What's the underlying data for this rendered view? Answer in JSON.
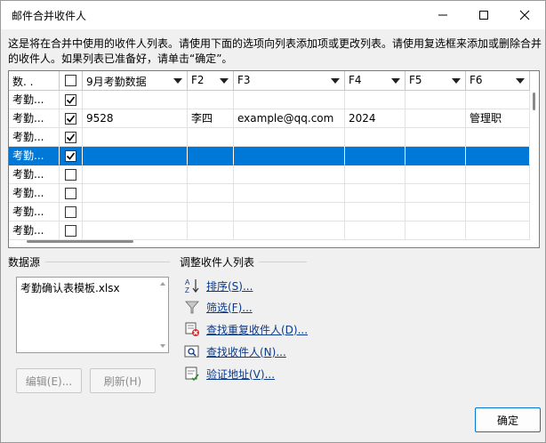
{
  "window": {
    "title": "邮件合并收件人"
  },
  "instructions": "这是将在合并中使用的收件人列表。请使用下面的选项向列表添加项或更改列表。请使用复选框来添加或删除合并的收件人。如果列表已准备好，请单击“确定”。",
  "grid": {
    "headers": [
      "数. .",
      "",
      "9月考勤数据",
      "F2",
      "F3",
      "F4",
      "F5",
      "F6"
    ],
    "rows": [
      {
        "source": "考勤...",
        "checked": true,
        "cells": [
          "",
          "",
          "",
          "",
          "",
          ""
        ]
      },
      {
        "source": "考勤...",
        "checked": true,
        "cells": [
          "9528",
          "李四",
          "example@qq.com",
          "2024",
          "",
          "管理职"
        ]
      },
      {
        "source": "考勤...",
        "checked": true,
        "cells": [
          "",
          "",
          "",
          "",
          "",
          ""
        ]
      },
      {
        "source": "考勤...",
        "checked": true,
        "cells": [
          "",
          "",
          "",
          "",
          "",
          ""
        ],
        "selected": true
      },
      {
        "source": "考勤...",
        "checked": false,
        "cells": [
          "",
          "",
          "",
          "",
          "",
          ""
        ]
      },
      {
        "source": "考勤...",
        "checked": false,
        "cells": [
          "",
          "",
          "",
          "",
          "",
          ""
        ]
      },
      {
        "source": "考勤...",
        "checked": false,
        "cells": [
          "",
          "",
          "",
          "",
          "",
          ""
        ]
      },
      {
        "source": "考勤...",
        "checked": false,
        "cells": [
          "",
          "",
          "",
          "",
          "",
          ""
        ]
      }
    ]
  },
  "datasource": {
    "label": "数据源",
    "items": [
      "考勤确认表模板.xlsx"
    ],
    "edit_label": "编辑(E)...",
    "refresh_label": "刷新(H)"
  },
  "refine": {
    "label": "调整收件人列表",
    "links": [
      {
        "name": "sort",
        "label": "排序(S)...",
        "icon": "sort-az-icon"
      },
      {
        "name": "filter",
        "label": "筛选(F)...",
        "icon": "filter-icon"
      },
      {
        "name": "duplicates",
        "label": "查找重复收件人(D)...",
        "icon": "find-duplicates-icon"
      },
      {
        "name": "find",
        "label": "查找收件人(N)...",
        "icon": "find-recipient-icon"
      },
      {
        "name": "validate",
        "label": "验证地址(V)...",
        "icon": "validate-address-icon"
      }
    ]
  },
  "ok_label": "确定",
  "colors": {
    "selection": "#0078d7",
    "link": "#0a3a8a",
    "accent": "#0078d7"
  }
}
